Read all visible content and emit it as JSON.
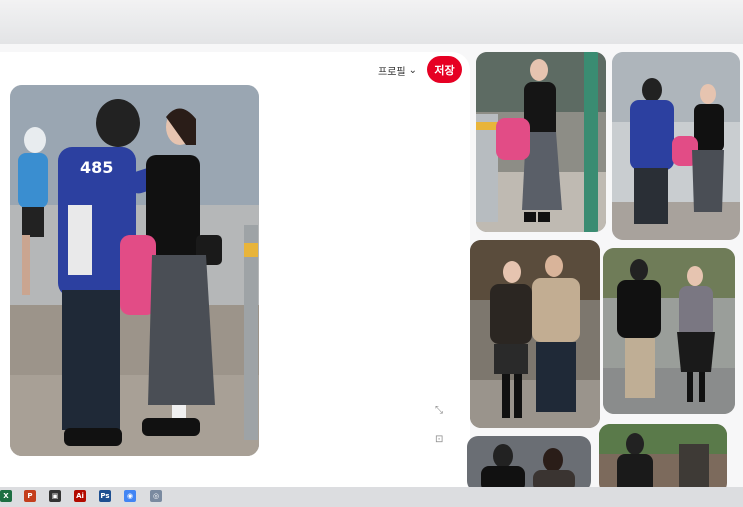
{
  "header": {
    "profile_label": "프로필",
    "save_label": "저장"
  },
  "colors": {
    "save_button": "#e60023",
    "jacket_blue": "#2c40a0",
    "skirt_gray": "#4a4e55"
  },
  "main_photo": {
    "jersey_text": "485"
  },
  "icons": {
    "profile_chevron": "chevron-down-icon",
    "expand": "expand-icon",
    "lens": "visual-search-icon"
  },
  "taskbar": {
    "apps": [
      {
        "name": "excel",
        "glyph": "X",
        "color": "#1d6f42"
      },
      {
        "name": "powerpoint",
        "glyph": "P",
        "color": "#c43e1c"
      },
      {
        "name": "notes",
        "glyph": "▣",
        "color": "#333333"
      },
      {
        "name": "acrobat",
        "glyph": "Ai",
        "color": "#b30b00"
      },
      {
        "name": "photoshop",
        "glyph": "Ps",
        "color": "#1d4f91"
      },
      {
        "name": "chrome",
        "glyph": "◉",
        "color": "#4285f4"
      },
      {
        "name": "other",
        "glyph": "◎",
        "color": "#7a8aa0"
      }
    ]
  }
}
